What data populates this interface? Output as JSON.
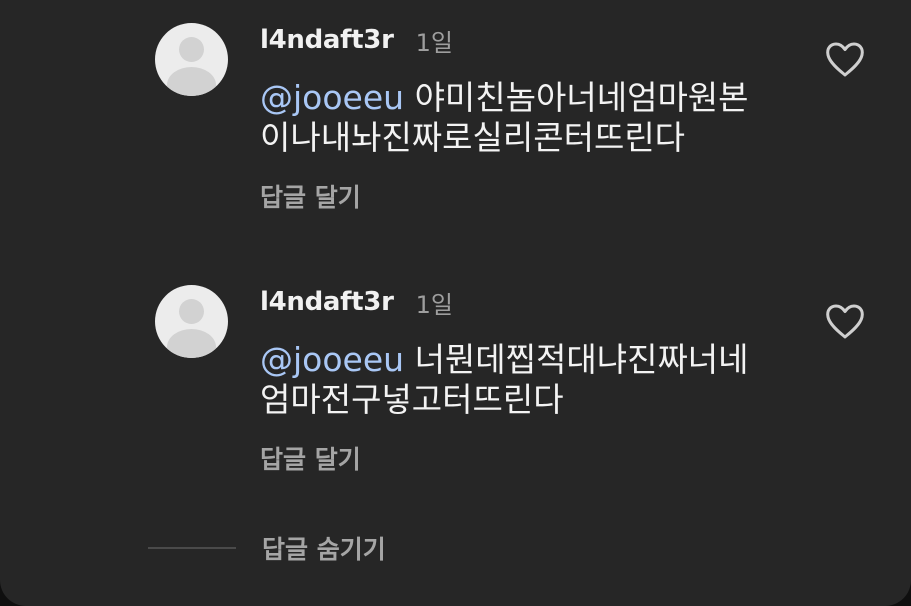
{
  "comments": [
    {
      "username": "l4ndaft3r",
      "time": "1일",
      "mention": "@jooeeu",
      "text_line1": " 야미친놈아너네엄마원본",
      "text_line2": "이나내놔진짜로실리콘터뜨린다",
      "reply_label": "답글 달기",
      "avatar_icon": "default-avatar-icon",
      "like_icon": "heart-outline-icon"
    },
    {
      "username": "l4ndaft3r",
      "time": "1일",
      "mention": "@jooeeu",
      "text_line1": " 너뭔데찝적대냐진짜너네",
      "text_line2": "엄마전구넣고터뜨린다",
      "reply_label": "답글 달기",
      "avatar_icon": "default-avatar-icon",
      "like_icon": "heart-outline-icon"
    }
  ],
  "footer": {
    "hide_replies_label": "답글 숨기기"
  },
  "colors": {
    "background": "#262626",
    "mention": "#a9c7f5",
    "secondary_text": "#a5a5a5"
  }
}
